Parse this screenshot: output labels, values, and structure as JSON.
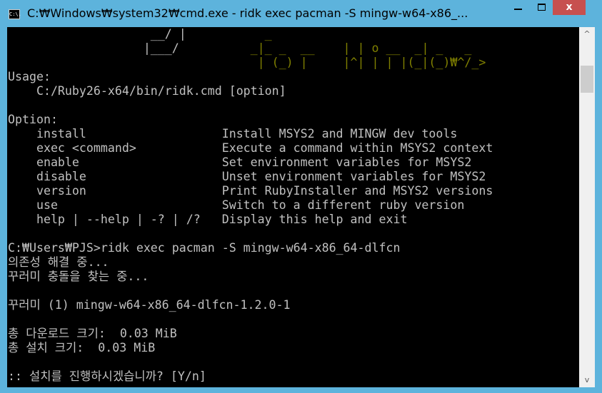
{
  "window": {
    "title": "C:₩Windows₩system32₩cmd.exe - ridk  exec pacman -S mingw-w64-x86_...",
    "icon": "cmd-icon",
    "icon_text": "C:\\.",
    "close_label": "x"
  },
  "colors": {
    "console_bg": "#000000",
    "text": "#c0c0c0",
    "logo_yellow": "#808000",
    "frame": "#5db3dc",
    "close": "#c7504f"
  },
  "console": {
    "art": [
      {
        "white": "                    __/ |",
        "yellow": "           _"
      },
      {
        "white": "                   |___/",
        "yellow": "          _|_ _  __    | | o __  _| _   _"
      },
      {
        "white": "",
        "yellow": "                                   | (_) |     |^| | | |(_|(_)₩^/_>"
      }
    ],
    "lines": [
      "Usage:",
      "    C:/Ruby26-x64/bin/ridk.cmd [option]",
      "",
      "Option:",
      "    install                   Install MSYS2 and MINGW dev tools",
      "    exec <command>            Execute a command within MSYS2 context",
      "    enable                    Set environment variables for MSYS2",
      "    disable                   Unset environment variables for MSYS2",
      "    version                   Print RubyInstaller and MSYS2 versions",
      "    use                       Switch to a different ruby version",
      "    help | --help | -? | /?   Display this help and exit",
      "",
      "C:₩Users₩PJS>ridk exec pacman -S mingw-w64-x86_64-dlfcn",
      "의존성 해결 중...",
      "꾸러미 충돌을 찾는 중...",
      "",
      "꾸러미 (1) mingw-w64-x86_64-dlfcn-1.2.0-1",
      "",
      "총 다운로드 크기:  0.03 MiB",
      "총 설치 크기:  0.03 MiB",
      "",
      ":: 설치를 진행하시겠습니까? [Y/n]"
    ]
  },
  "scrollbar": {
    "up": "^",
    "down": "v"
  }
}
